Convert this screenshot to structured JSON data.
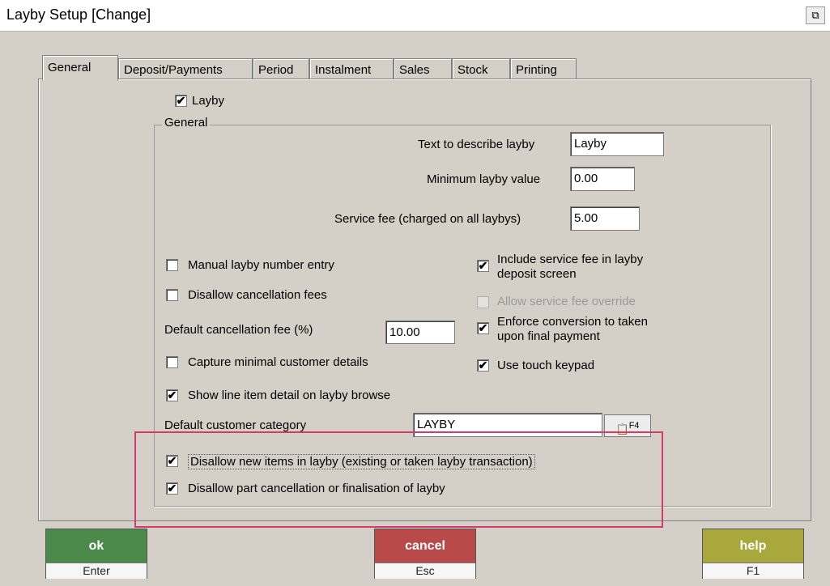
{
  "window": {
    "title": "Layby Setup  [Change]"
  },
  "tabs": [
    "General",
    "Deposit/Payments",
    "Period",
    "Instalment",
    "Sales",
    "Stock",
    "Printing"
  ],
  "layby_checkbox": {
    "label": "Layby",
    "checked": true
  },
  "group": {
    "label": "General"
  },
  "fields": {
    "text_describe": {
      "label": "Text to describe layby",
      "value": "Layby"
    },
    "min_value": {
      "label": "Minimum layby value",
      "value": "0.00"
    },
    "service_fee": {
      "label": "Service fee (charged on all laybys)",
      "value": "5.00"
    },
    "default_cancel_fee": {
      "label": "Default cancellation fee (%)",
      "value": "10.00"
    },
    "default_customer_category": {
      "label": "Default customer category",
      "value": "LAYBY",
      "lookup_key": "F4"
    }
  },
  "left_checks": [
    {
      "label": "Manual layby number entry",
      "checked": false
    },
    {
      "label": "Disallow cancellation fees",
      "checked": false
    },
    {
      "label": "Capture minimal customer details",
      "checked": false
    },
    {
      "label": "Show line item detail on layby browse",
      "checked": true
    }
  ],
  "right_checks": [
    {
      "label1": "Include service fee in layby",
      "label2": "deposit screen",
      "checked": true,
      "enabled": true
    },
    {
      "label1": "Allow service fee override",
      "label2": "",
      "checked": false,
      "enabled": false
    },
    {
      "label1": "Enforce conversion to taken",
      "label2": "upon final payment",
      "checked": true,
      "enabled": true
    },
    {
      "label1": "Use touch keypad",
      "label2": "",
      "checked": true,
      "enabled": true
    }
  ],
  "highlighted_checks": [
    {
      "label": "Disallow new items in layby (existing or taken layby transaction)",
      "checked": true
    },
    {
      "label": "Disallow part cancellation or finalisation of layby",
      "checked": true
    }
  ],
  "buttons": {
    "ok": {
      "label": "ok",
      "key": "Enter",
      "color": "#4c8a4c"
    },
    "cancel": {
      "label": "cancel",
      "key": "Esc",
      "color": "#b84a4a"
    },
    "help": {
      "label": "help",
      "key": "F1",
      "color": "#a8a83c"
    }
  },
  "colors": {
    "highlight_border": "#d63a6a"
  }
}
